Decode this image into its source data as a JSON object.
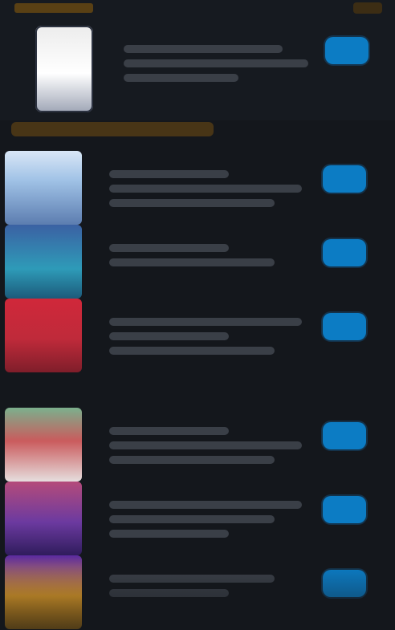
{
  "colors": {
    "background": "#14171c",
    "accent_gold": "#6a4a12",
    "action_blue": "#0c7cc4",
    "placeholder": "#3a3f47"
  },
  "featured": {
    "thumb_icon": "image-icon",
    "button_icon": "action-button"
  },
  "list": {
    "items": [
      {
        "thumb_icon": "image-icon",
        "variant": "v-sky"
      },
      {
        "thumb_icon": "image-icon",
        "variant": "v-ocean"
      },
      {
        "thumb_icon": "image-icon",
        "variant": "v-red"
      },
      {
        "thumb_icon": "image-icon",
        "variant": "v-mix"
      },
      {
        "thumb_icon": "image-icon",
        "variant": "v-purple"
      },
      {
        "thumb_icon": "image-icon",
        "variant": "v-gold"
      }
    ]
  }
}
